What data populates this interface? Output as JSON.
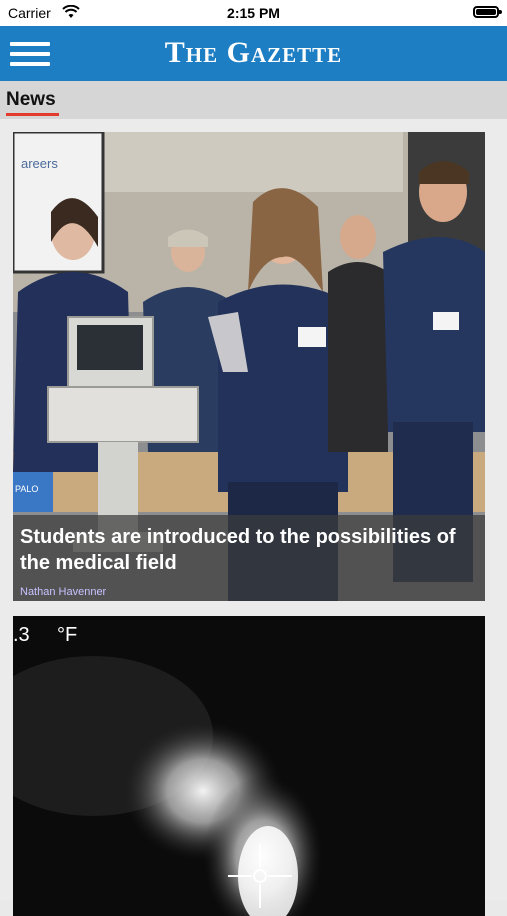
{
  "status_bar": {
    "carrier": "Carrier",
    "time": "2:15 PM"
  },
  "header": {
    "title": "The Gazette",
    "brand_color": "#1e7ec3"
  },
  "section": {
    "active_tab": "News",
    "accent_color": "#e23b2e"
  },
  "articles": [
    {
      "headline": "Students are introduced to the possibilities of the medical field",
      "byline": "Nathan Havenner",
      "poster_text": "areers",
      "sign_text": "PALO"
    },
    {
      "readout_value": ".3",
      "readout_unit": "°F"
    }
  ],
  "icons": [
    "menu-icon",
    "wifi-icon",
    "battery-icon",
    "crosshair-icon"
  ]
}
